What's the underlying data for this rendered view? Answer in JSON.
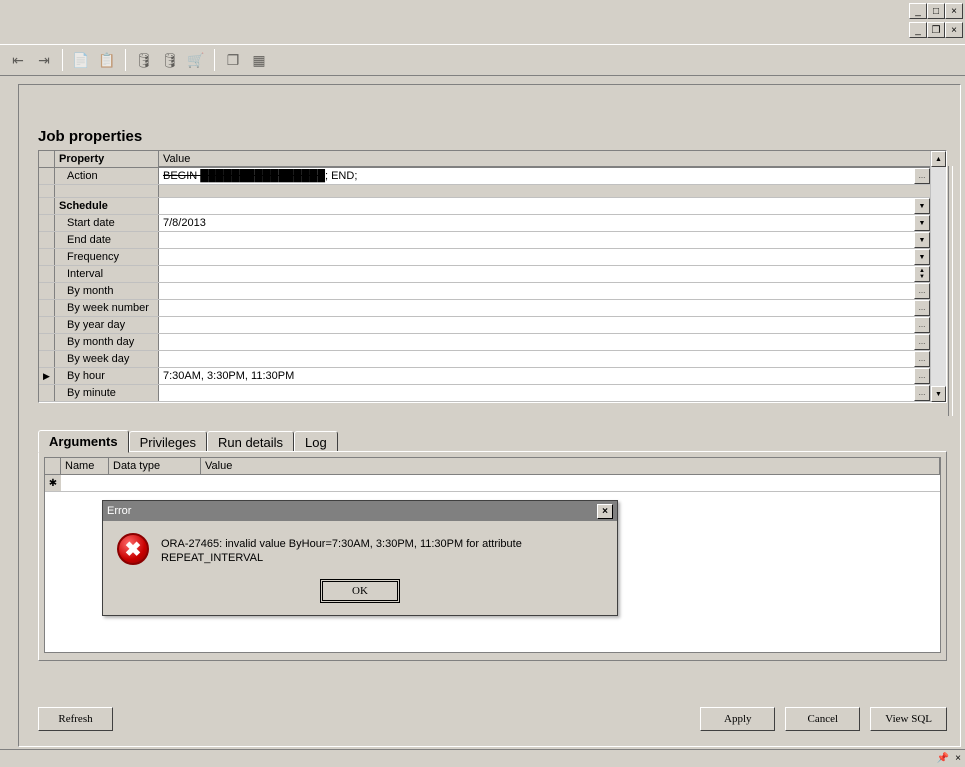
{
  "window_controls": {
    "minimize": "_",
    "maximize": "□",
    "close": "×",
    "restore": "❐"
  },
  "section_title": "Job properties",
  "prop_columns": {
    "property": "Property",
    "value": "Value"
  },
  "action_row": {
    "label": "Action",
    "value_redacted": "BEGIN ████████████████",
    "value_tail": "; END;"
  },
  "schedule_header": "Schedule",
  "rows": {
    "start_date": {
      "label": "Start date",
      "value": "7/8/2013"
    },
    "end_date": {
      "label": "End date",
      "value": ""
    },
    "frequency": {
      "label": "Frequency",
      "value": ""
    },
    "interval": {
      "label": "Interval",
      "value": ""
    },
    "by_month": {
      "label": "By month",
      "value": ""
    },
    "by_week_number": {
      "label": "By week number",
      "value": ""
    },
    "by_year_day": {
      "label": "By year day",
      "value": ""
    },
    "by_month_day": {
      "label": "By month day",
      "value": ""
    },
    "by_week_day": {
      "label": "By week day",
      "value": ""
    },
    "by_hour": {
      "label": "By hour",
      "value": "7:30AM, 3:30PM, 11:30PM"
    },
    "by_minute": {
      "label": "By minute",
      "value": ""
    }
  },
  "tabs": {
    "arguments": "Arguments",
    "privileges": "Privileges",
    "run_details": "Run details",
    "log": "Log"
  },
  "args_columns": {
    "name": "Name",
    "data_type": "Data type",
    "value": "Value"
  },
  "buttons": {
    "refresh": "Refresh",
    "apply": "Apply",
    "cancel": "Cancel",
    "view_sql": "View SQL"
  },
  "error_dialog": {
    "title": "Error",
    "message": "ORA-27465: invalid value ByHour=7:30AM, 3:30PM, 11:30PM for attribute REPEAT_INTERVAL",
    "ok": "OK"
  },
  "statusbar": {
    "pin": "📌",
    "close": "×"
  }
}
